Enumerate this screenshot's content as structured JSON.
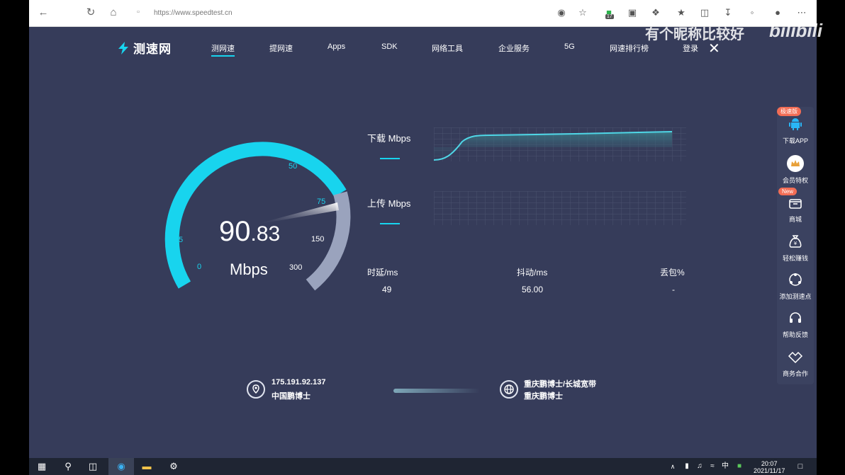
{
  "browser": {
    "url": "https://www.speedtest.cn",
    "badge_count": "17"
  },
  "site": {
    "logo_text": "测速网",
    "nav": [
      "测网速",
      "提网速",
      "Apps",
      "SDK",
      "网络工具",
      "企业服务",
      "5G",
      "网速排行榜",
      "登录"
    ],
    "active_nav": "测网速"
  },
  "watermark": {
    "text": "有个昵称比较好",
    "brand": "bilibili"
  },
  "gauge": {
    "ticks": [
      "0",
      "5",
      "10",
      "15",
      "25",
      "50",
      "75",
      "150",
      "300"
    ],
    "speed_int": "90",
    "speed_dec": ".83",
    "unit": "Mbps",
    "accent": "#18d4ee",
    "track": "#9aa3bd"
  },
  "download": {
    "label": "下载 Mbps"
  },
  "upload": {
    "label": "上传 Mbps"
  },
  "stats": {
    "latency_label": "时延/ms",
    "latency_value": "49",
    "jitter_label": "抖动/ms",
    "jitter_value": "56.00",
    "loss_label": "丢包%",
    "loss_value": "-"
  },
  "client": {
    "ip": "175.191.92.137",
    "isp": "中国鹏博士"
  },
  "server": {
    "name": "重庆鹏博士/长城宽带",
    "isp": "重庆鹏博士"
  },
  "sidebar": {
    "items": [
      {
        "label": "下载APP",
        "badge": "极速版",
        "icon": "android-icon"
      },
      {
        "label": "会员特权",
        "icon": "crown-icon"
      },
      {
        "label": "商城",
        "badge": "New",
        "icon": "shop-icon"
      },
      {
        "label": "轻松赚钱",
        "icon": "money-bag-icon"
      },
      {
        "label": "添加测速点",
        "icon": "network-node-icon"
      },
      {
        "label": "帮助反馈",
        "icon": "headset-icon"
      },
      {
        "label": "商务合作",
        "icon": "handshake-icon"
      }
    ]
  },
  "taskbar": {
    "time": "20:07",
    "date": "2021/11/17",
    "ime": "中"
  }
}
